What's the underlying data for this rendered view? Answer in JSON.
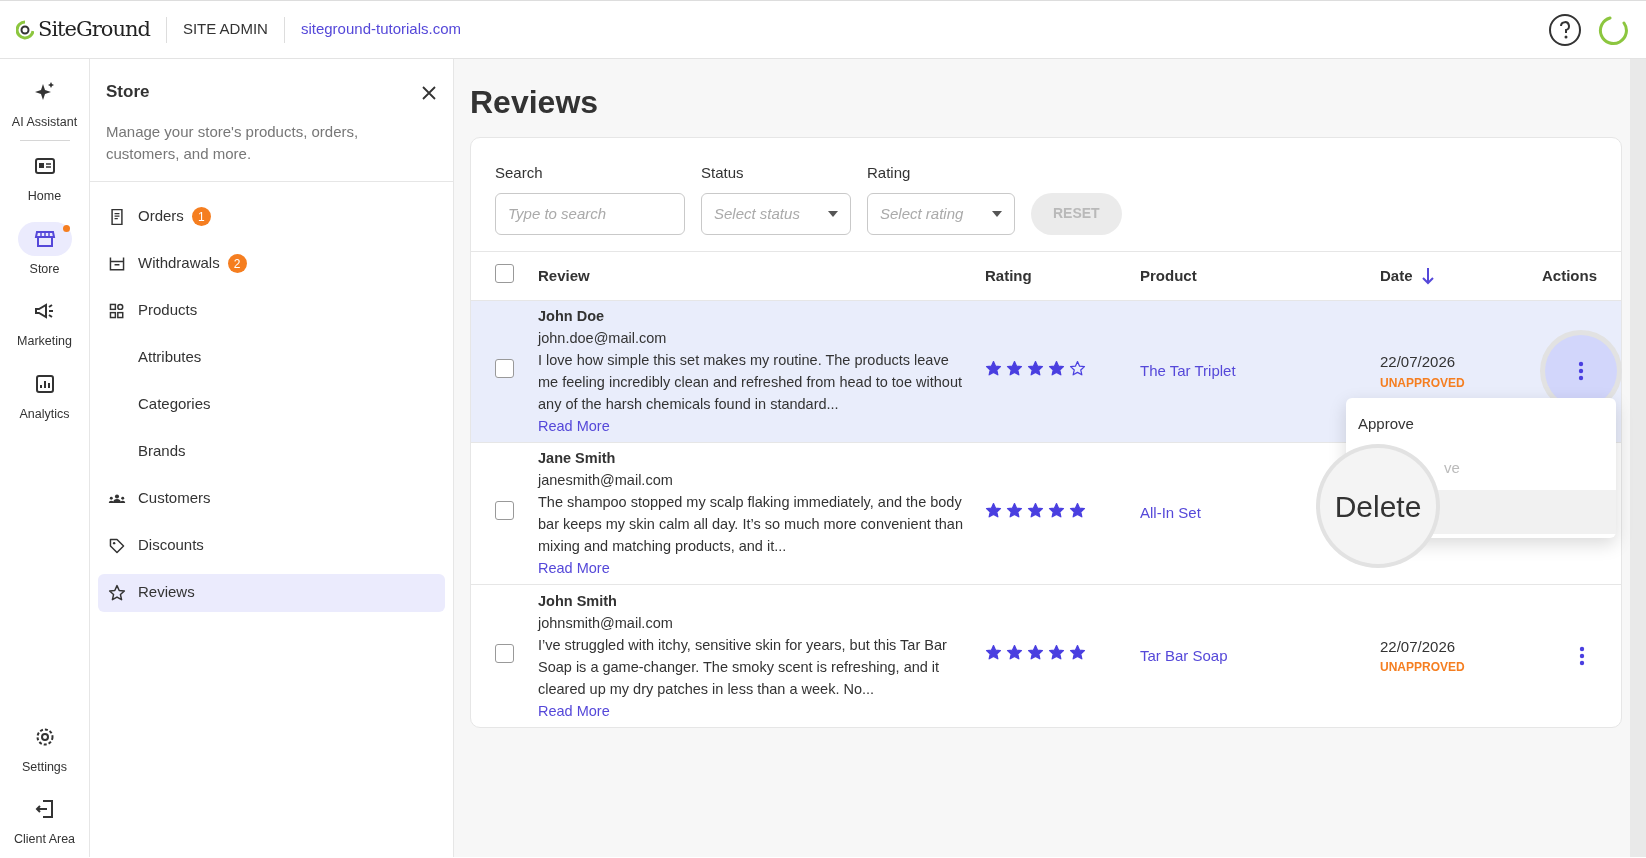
{
  "header": {
    "logo": "SiteGround",
    "section": "SITE ADMIN",
    "site": "siteground-tutorials.com"
  },
  "rail": {
    "top": [
      {
        "label": "AI Assistant",
        "selected": false,
        "dot": false
      }
    ],
    "main": [
      {
        "label": "Home",
        "selected": false,
        "dot": false
      },
      {
        "label": "Store",
        "selected": true,
        "dot": true
      },
      {
        "label": "Marketing",
        "selected": false,
        "dot": false
      },
      {
        "label": "Analytics",
        "selected": false,
        "dot": false
      }
    ],
    "bottom": [
      {
        "label": "Settings",
        "selected": false,
        "dot": false
      },
      {
        "label": "Client Area",
        "selected": false,
        "dot": false
      }
    ]
  },
  "panel": {
    "title": "Store",
    "description": "Manage your store's products, orders, customers, and more.",
    "items": [
      {
        "label": "Orders",
        "badge": "1",
        "selected": false
      },
      {
        "label": "Withdrawals",
        "badge": "2",
        "selected": false
      },
      {
        "label": "Products",
        "selected": false
      },
      {
        "label": "Attributes",
        "selected": false
      },
      {
        "label": "Categories",
        "selected": false
      },
      {
        "label": "Brands",
        "selected": false
      },
      {
        "label": "Customers",
        "selected": false
      },
      {
        "label": "Discounts",
        "selected": false
      },
      {
        "label": "Reviews",
        "selected": true
      }
    ]
  },
  "page_title": "Reviews",
  "filters": {
    "search": {
      "label": "Search",
      "placeholder": "Type to search"
    },
    "status": {
      "label": "Status",
      "placeholder": "Select status"
    },
    "rating": {
      "label": "Rating",
      "placeholder": "Select rating"
    },
    "reset": "RESET"
  },
  "table": {
    "columns": [
      "Review",
      "Rating",
      "Product",
      "Date",
      "Actions"
    ],
    "all_checked": false,
    "rows": [
      {
        "name": "John Doe",
        "email": "john.doe@mail.com",
        "text": "I love how simple this set makes my routine. The products leave me feeling incredibly clean and refreshed from head to toe without any of the harsh chemicals found in standard...",
        "read_more": "Read More",
        "stars": 4,
        "product": "The Tar Triplet",
        "date": "22/07/2026",
        "status": "UNAPPROVED",
        "checked": false,
        "selected": true,
        "menu_open": true
      },
      {
        "name": "Jane Smith",
        "email": "janesmith@mail.com",
        "text": "The shampoo stopped my scalp flaking immediately, and the body bar keeps my skin calm all day. It’s so much more convenient than mixing and matching products, and it...",
        "read_more": "Read More",
        "stars": 5,
        "product": "All-In Set",
        "checked": false,
        "selected": false,
        "menu_open": false
      },
      {
        "name": "John Smith",
        "email": "johnsmith@mail.com",
        "text": "I’ve struggled with itchy, sensitive skin for years, but this Tar Bar Soap is a game-changer. The smoky scent is refreshing, and it cleared up my dry patches in less than a week. No...",
        "read_more": "Read More",
        "stars": 5,
        "product": "Tar Bar Soap",
        "date": "22/07/2026",
        "status": "UNAPPROVED",
        "checked": false,
        "selected": false,
        "menu_open": false
      }
    ]
  },
  "action_menu": [
    {
      "label": "Approve",
      "highlighted": false,
      "faded": false
    },
    {
      "label": "ve",
      "highlighted": false,
      "faded": true
    },
    {
      "label": "Delete",
      "highlighted": true,
      "faded": false,
      "magnified": true
    }
  ]
}
